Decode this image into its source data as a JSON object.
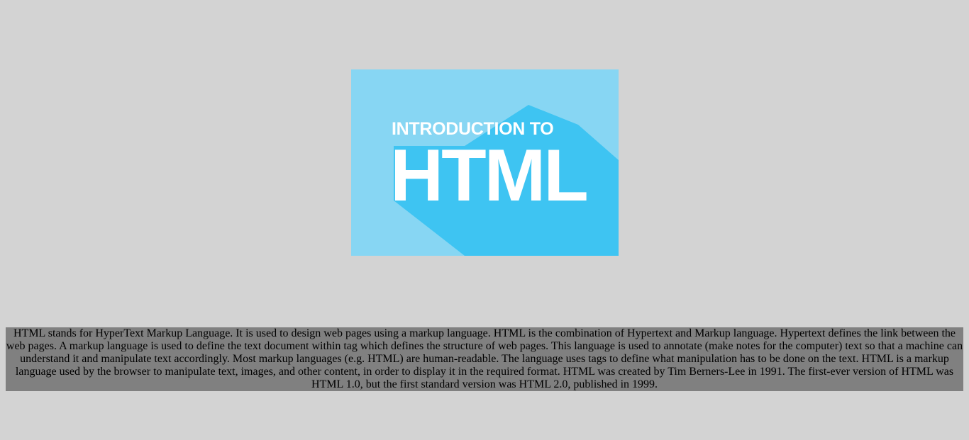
{
  "banner": {
    "line1": "INTRODUCTION TO",
    "line2": "HTML",
    "background_color": "#87d6f3",
    "shadow_color": "#3ec4f2",
    "text_color": "#ffffff"
  },
  "description": {
    "text": "HTML stands for HyperText Markup Language. It is used to design web pages using a markup language. HTML is the combination of Hypertext and Markup language. Hypertext defines the link between the web pages. A markup language is used to define the text document within tag which defines the structure of web pages. This language is used to annotate (make notes for the computer) text so that a machine can understand it and manipulate text accordingly. Most markup languages (e.g. HTML) are human-readable. The language uses tags to define what manipulation has to be done on the text. HTML is a markup language used by the browser to manipulate text, images, and other content, in order to display it in the required format. HTML was created by Tim Berners-Lee in 1991. The first-ever version of HTML was HTML 1.0, but the first standard version was HTML 2.0, published in 1999.",
    "background_color": "#808080"
  },
  "page": {
    "background_color": "#d3d3d3"
  }
}
